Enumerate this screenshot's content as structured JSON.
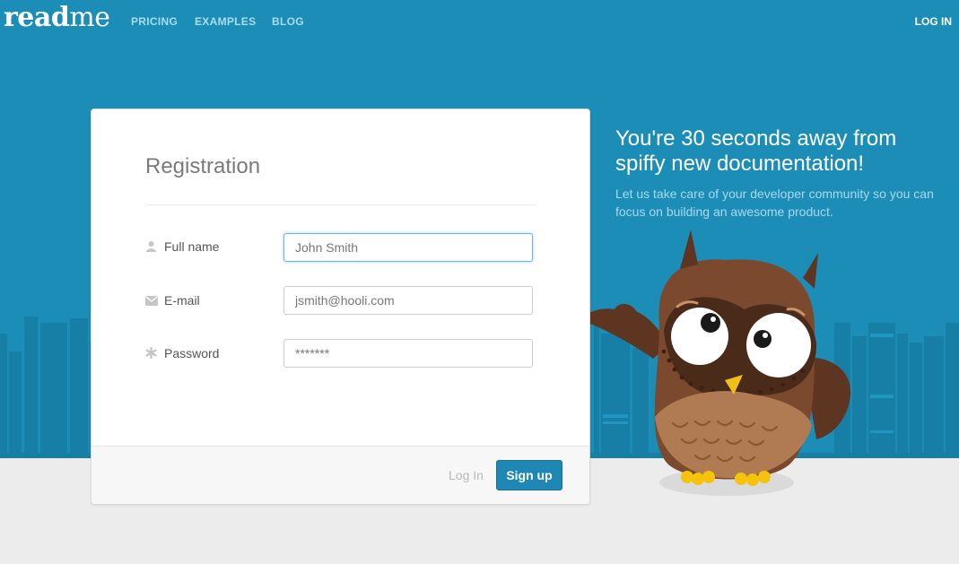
{
  "nav": {
    "logo_bold": "read",
    "logo_light": "me",
    "links": [
      "PRICING",
      "EXAMPLES",
      "BLOG"
    ],
    "login": "LOG IN"
  },
  "form": {
    "title": "Registration",
    "fields": [
      {
        "label": "Full name",
        "icon": "user-icon",
        "placeholder": "John Smith",
        "value": ""
      },
      {
        "label": "E-mail",
        "icon": "envelope-icon",
        "placeholder": "jsmith@hooli.com",
        "value": ""
      },
      {
        "label": "Password",
        "icon": "asterisk-icon",
        "placeholder": "*******",
        "value": ""
      }
    ],
    "footer_login": "Log In",
    "signup": "Sign up"
  },
  "promo": {
    "title": "You're 30 seconds away from spiffy new documentation!",
    "subtitle": "Let us take care of your developer community so you can focus on building an awesome product."
  },
  "colors": {
    "hero": "#1b8db6",
    "accent": "#1e87b4",
    "owl_body": "#7b4a2e"
  }
}
